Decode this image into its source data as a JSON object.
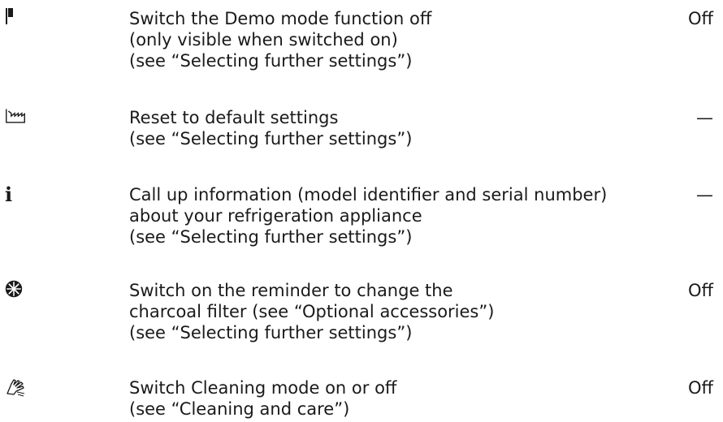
{
  "settings": [
    {
      "icon": "demo-mode-flag-icon",
      "lines": [
        "Switch the Demo mode function off",
        "(only visible when switched on)",
        "(see “Selecting further settings”)"
      ],
      "value": "Off"
    },
    {
      "icon": "factory-default-icon",
      "lines": [
        "Reset to default settings",
        "(see “Selecting further settings”)"
      ],
      "value": "—"
    },
    {
      "icon": "information-icon",
      "icon_text": "i",
      "lines": [
        "Call up information (model identifier and serial number)",
        "about your refrigeration appliance",
        "(see “Selecting further settings”)"
      ],
      "value": "—"
    },
    {
      "icon": "charcoal-filter-icon",
      "lines": [
        "Switch on the reminder to change the",
        "charcoal filter (see “Optional accessories”)",
        "(see “Selecting further settings”)"
      ],
      "value": "Off"
    },
    {
      "icon": "cleaning-hand-icon",
      "lines": [
        "Switch Cleaning mode on or off",
        "(see “Cleaning and care”)"
      ],
      "value": "Off"
    }
  ]
}
